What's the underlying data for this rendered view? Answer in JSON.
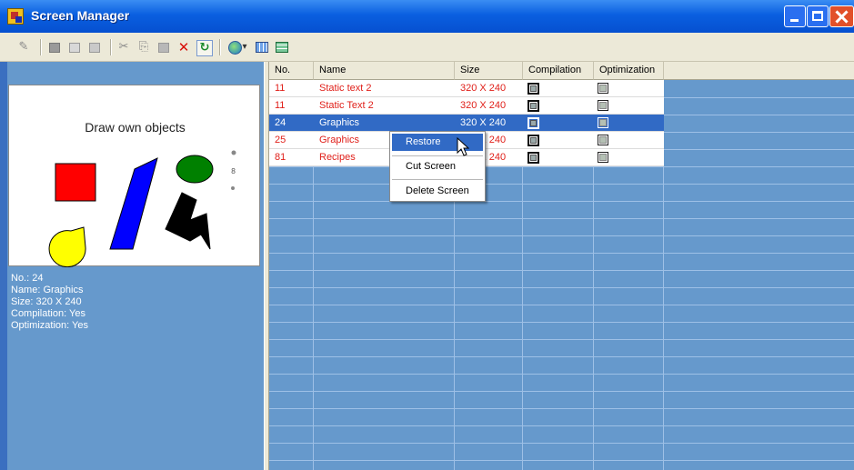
{
  "window": {
    "title": "Screen Manager",
    "icon": "app-icon"
  },
  "toolbar": {
    "icons": [
      "pen-icon",
      "screen-icon",
      "screen-light-icon",
      "folder-icon",
      "cut-icon",
      "copy-icon",
      "paste-icon",
      "delete-icon",
      "refresh-icon",
      "globe-icon",
      "dropdown-icon",
      "list-view-icon",
      "grid-view-icon"
    ],
    "glyphs": {
      "pen": "✎",
      "cut": "✂",
      "copy": "⎘",
      "paste": "📋",
      "delete": "✕",
      "refresh": "↻",
      "dropdown": "▾"
    }
  },
  "preview": {
    "title": "Draw own objects",
    "shapes": {
      "square": "#ff0000",
      "parallelogram": "#0000ff",
      "ellipse": "#008000",
      "pacman": "#ffff00",
      "bolt": "#000000"
    }
  },
  "info": {
    "no": "No.: 24",
    "name": "Name: Graphics",
    "size": "Size: 320 X 240",
    "compilation": "Compilation: Yes",
    "optimization": "Optimization: Yes"
  },
  "table": {
    "columns": [
      "No.",
      "Name",
      "Size",
      "Compilation",
      "Optimization"
    ],
    "rows": [
      {
        "no": "11",
        "name": "Static text 2",
        "size": "320 X 240",
        "compilation": true,
        "optimization": true,
        "selected": false
      },
      {
        "no": "11",
        "name": "Static Text 2",
        "size": "320 X 240",
        "compilation": true,
        "optimization": true,
        "selected": false
      },
      {
        "no": "24",
        "name": "Graphics",
        "size": "320 X 240",
        "compilation": true,
        "optimization": true,
        "selected": true
      },
      {
        "no": "25",
        "name": "Graphics",
        "size": "320 X 240",
        "compilation": true,
        "optimization": true,
        "selected": false
      },
      {
        "no": "81",
        "name": "Recipes",
        "size": "320 X 240",
        "compilation": true,
        "optimization": true,
        "selected": false
      }
    ]
  },
  "context_menu": {
    "items": [
      "Restore",
      "Cut Screen",
      "Delete Screen"
    ],
    "highlighted": "Restore"
  },
  "colors": {
    "row_text": "#e0201a",
    "selection": "#316ac5",
    "panel_bg": "#6699cc",
    "titlebar": "#0a5fe0"
  }
}
